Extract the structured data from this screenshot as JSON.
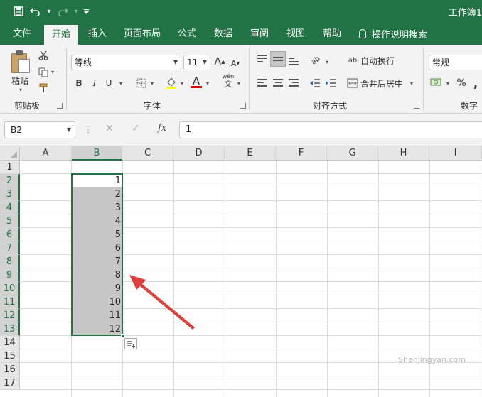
{
  "title_bar": {
    "doc_title": "工作簿1",
    "save_icon": "save-icon",
    "undo_icon": "undo-icon",
    "redo_icon": "redo-icon",
    "customize_icon": "customize-qat-icon"
  },
  "tabs": [
    {
      "label": "文件"
    },
    {
      "label": "开始"
    },
    {
      "label": "插入"
    },
    {
      "label": "页面布局"
    },
    {
      "label": "公式"
    },
    {
      "label": "数据"
    },
    {
      "label": "审阅"
    },
    {
      "label": "视图"
    },
    {
      "label": "帮助"
    }
  ],
  "tell_me": "操作说明搜索",
  "ribbon": {
    "clipboard": {
      "paste_label": "粘贴",
      "group_label": "剪贴板"
    },
    "font": {
      "font_name": "等线",
      "font_size": "11",
      "bold": "B",
      "italic": "I",
      "underline": "U",
      "grow": "A",
      "shrink": "A",
      "font_color_glyph": "A",
      "phonetic_top": "wén",
      "phonetic_bottom": "文",
      "group_label": "字体"
    },
    "alignment": {
      "wrap_text": "自动换行",
      "merge_center": "合并后居中",
      "orientation_glyph": "ab",
      "wrap_glyph": "ab",
      "group_label": "对齐方式"
    },
    "number": {
      "format": "常规",
      "percent": "%",
      "comma": ",",
      "group_label": "数字"
    }
  },
  "formula_bar": {
    "name_box": "B2",
    "cancel_symbol": "✕",
    "enter_symbol": "✓",
    "fx_symbol": "fx",
    "content": "1"
  },
  "sheet": {
    "columns": [
      "A",
      "B",
      "C",
      "D",
      "E",
      "F",
      "G",
      "H",
      "I"
    ],
    "rows": [
      "1",
      "2",
      "3",
      "4",
      "5",
      "6",
      "7",
      "8",
      "9",
      "10",
      "11",
      "12",
      "13",
      "14",
      "15",
      "16",
      "17"
    ],
    "selected_column": "B",
    "column_b_values": [
      "1",
      "2",
      "3",
      "4",
      "5",
      "6",
      "7",
      "8",
      "9",
      "10",
      "11",
      "12"
    ]
  },
  "annotation_color": "#e0403c",
  "watermark": "Shenjingyan.com"
}
